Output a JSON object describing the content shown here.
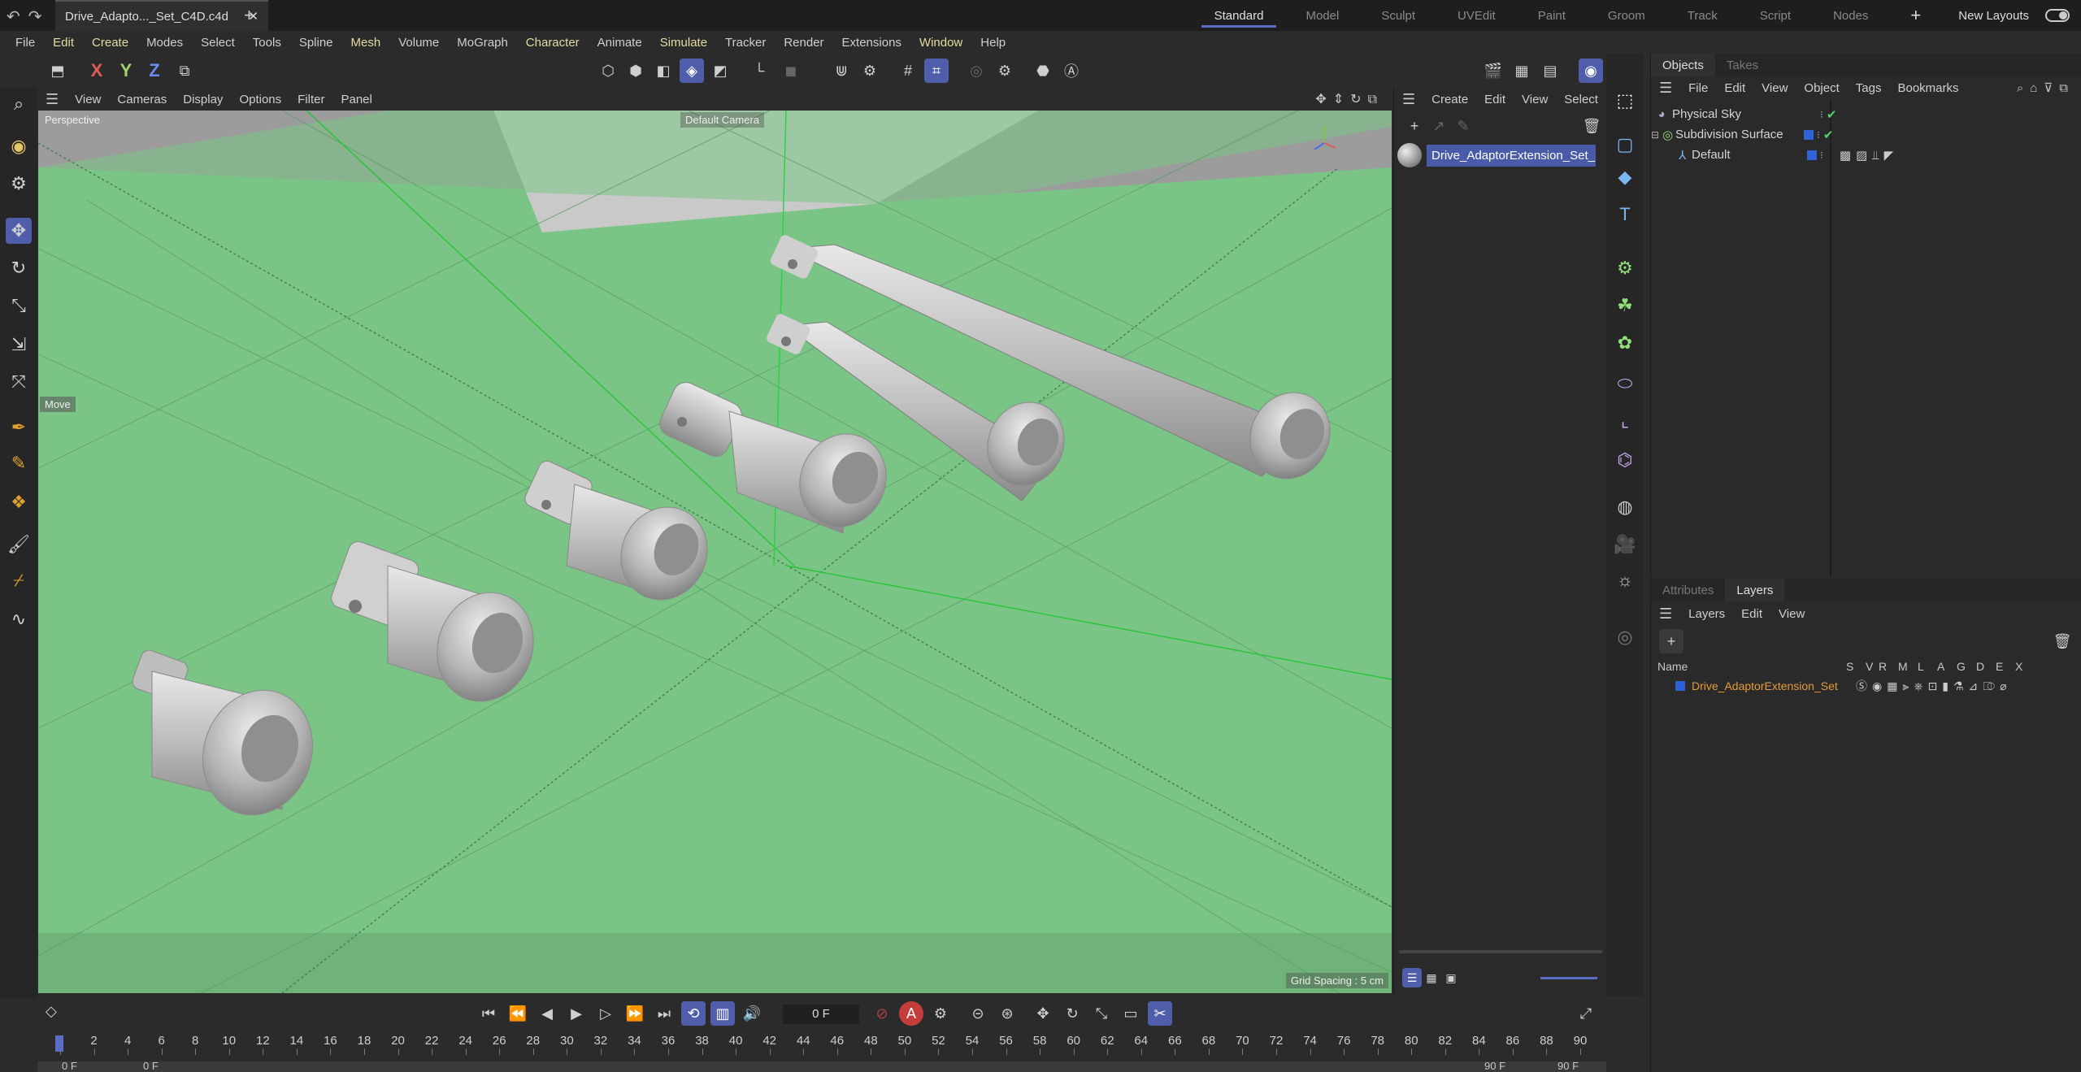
{
  "titlebar": {
    "document_tab": "Drive_Adapto..._Set_C4D.c4d",
    "layouts": [
      "Standard",
      "Model",
      "Sculpt",
      "UVEdit",
      "Paint",
      "Groom",
      "Track",
      "Script",
      "Nodes"
    ],
    "active_layout": "Standard",
    "new_layouts": "New Layouts"
  },
  "menubar": {
    "items": [
      "File",
      "Edit",
      "Create",
      "Modes",
      "Select",
      "Tools",
      "Spline",
      "Mesh",
      "Volume",
      "MoGraph",
      "Character",
      "Animate",
      "Simulate",
      "Tracker",
      "Render",
      "Extensions",
      "Window",
      "Help"
    ],
    "highlighted": [
      "Mesh",
      "Character",
      "Simulate",
      "Window"
    ]
  },
  "toolbar": {
    "axes": [
      "X",
      "Y",
      "Z"
    ]
  },
  "viewport": {
    "menu": [
      "View",
      "Cameras",
      "Display",
      "Options",
      "Filter",
      "Panel"
    ],
    "view_name": "Perspective",
    "camera_name": "Default Camera",
    "tool_label": "Move",
    "grid_spacing": "Grid Spacing : 5 cm"
  },
  "material_panel": {
    "menu": [
      "Create",
      "Edit",
      "View",
      "Select"
    ],
    "material_name": "Drive_AdaptorExtension_Set_Mtl"
  },
  "objects_panel": {
    "tabs": [
      "Objects",
      "Takes"
    ],
    "active_tab": "Objects",
    "menu": [
      "File",
      "Edit",
      "View",
      "Object",
      "Tags",
      "Bookmarks"
    ],
    "objects": [
      {
        "name": "Physical Sky",
        "indent": 0,
        "icon": "sky-icon"
      },
      {
        "name": "Subdivision Surface",
        "indent": 0,
        "icon": "subdivision-icon"
      },
      {
        "name": "Default",
        "indent": 1,
        "icon": "null-icon"
      }
    ]
  },
  "layers_panel": {
    "tabs": [
      "Attributes",
      "Layers"
    ],
    "active_tab": "Layers",
    "menu": [
      "Layers",
      "Edit",
      "View"
    ],
    "column_name": "Name",
    "flag_columns": [
      "S",
      "V",
      "R",
      "M",
      "L",
      "A",
      "G",
      "D",
      "E",
      "X"
    ],
    "layers": [
      {
        "name": "Drive_AdaptorExtension_Set",
        "color": "#2f5fd8"
      }
    ]
  },
  "timeline": {
    "current_frame": "0 F",
    "ticks": [
      "0",
      "2",
      "4",
      "6",
      "8",
      "10",
      "12",
      "14",
      "16",
      "18",
      "20",
      "22",
      "24",
      "26",
      "28",
      "30",
      "32",
      "34",
      "36",
      "38",
      "40",
      "42",
      "44",
      "46",
      "48",
      "50",
      "52",
      "54",
      "56",
      "58",
      "60",
      "62",
      "64",
      "66",
      "68",
      "70",
      "72",
      "74",
      "76",
      "78",
      "80",
      "82",
      "84",
      "86",
      "88",
      "90"
    ],
    "start_a": "0 F",
    "start_b": "0 F",
    "end_a": "90 F",
    "end_b": "90 F"
  },
  "colors": {
    "accent": "#4f5dab",
    "viewport_green": "#7ac585",
    "layer_name": "#e89a3c"
  }
}
